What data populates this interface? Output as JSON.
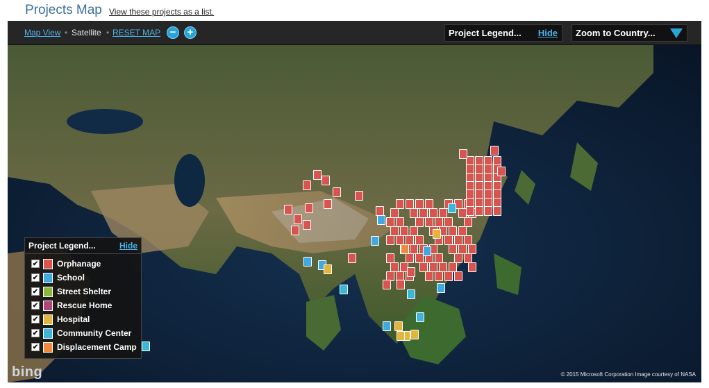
{
  "header": {
    "title": "Projects Map",
    "list_link": "View these projects as a list."
  },
  "toolbar": {
    "map_view": "Map View",
    "satellite": "Satellite",
    "reset_map": "RESET MAP",
    "zoom_out": "−",
    "zoom_in": "+",
    "legend_title": "Project Legend...",
    "legend_hide": "Hide",
    "zoom_country": "Zoom to Country..."
  },
  "legend": {
    "title": "Project Legend...",
    "hide": "Hide",
    "checked_mark": "✔",
    "items": [
      {
        "label": "Orphanage",
        "color": "#d9534f",
        "icon": "orphanage-icon",
        "checked": true
      },
      {
        "label": "School",
        "color": "#3fa9e0",
        "icon": "school-icon",
        "checked": true
      },
      {
        "label": "Street Shelter",
        "color": "#8db63c",
        "icon": "street-shelter-icon",
        "checked": true
      },
      {
        "label": "Rescue Home",
        "color": "#b0467a",
        "icon": "rescue-home-icon",
        "checked": true
      },
      {
        "label": "Hospital",
        "color": "#e3b53c",
        "icon": "hospital-icon",
        "checked": true
      },
      {
        "label": "Community Center",
        "color": "#3bb8d9",
        "icon": "community-center-icon",
        "checked": true
      },
      {
        "label": "Displacement Camp",
        "color": "#f08a3c",
        "icon": "displacement-camp-icon",
        "checked": true
      }
    ]
  },
  "map": {
    "provider_logo": "bing",
    "copyright": "© 2015 Microsoft Corporation     Image courtesy of NASA"
  },
  "colors": {
    "accent": "#2aa3d9",
    "title_blue": "#3b6e9e",
    "link_blue": "#4fb3e8"
  }
}
